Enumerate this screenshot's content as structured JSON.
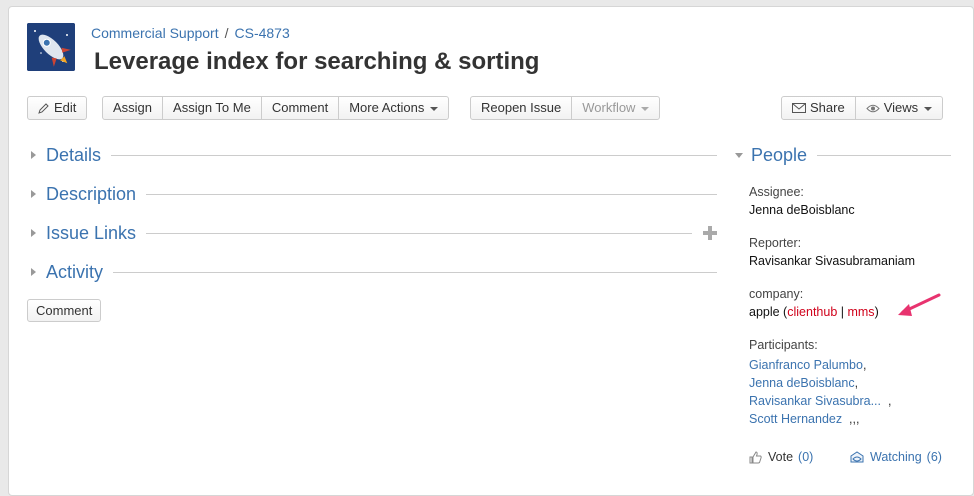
{
  "breadcrumb": {
    "project": "Commercial Support",
    "separator": "/",
    "issue_key": "CS-4873"
  },
  "title": "Leverage index for searching & sorting",
  "toolbar": {
    "edit": "Edit",
    "assign": "Assign",
    "assign_to_me": "Assign To Me",
    "comment": "Comment",
    "more_actions": "More Actions",
    "reopen_issue": "Reopen Issue",
    "workflow": "Workflow",
    "share": "Share",
    "views": "Views"
  },
  "sections": {
    "details": "Details",
    "description": "Description",
    "issue_links": "Issue Links",
    "activity": "Activity"
  },
  "comment_button": "Comment",
  "people": {
    "heading": "People",
    "assignee_label": "Assignee:",
    "assignee": "Jenna deBoisblanc",
    "reporter_label": "Reporter:",
    "reporter": "Ravisankar Sivasubramaniam",
    "company_label": "company:",
    "company_prefix": "apple (",
    "company_link1": "clienthub",
    "company_sep": " | ",
    "company_link2": "mms",
    "company_suffix": ")",
    "participants_label": "Participants:",
    "participants": [
      "Gianfranco Palumbo",
      "Jenna deBoisblanc",
      "Ravisankar Sivasubra...",
      "Scott Hernandez"
    ],
    "participant_suffixes": [
      ",",
      ",",
      "  ,",
      "  ,,,"
    ],
    "vote_label": "Vote",
    "vote_count": "(0)",
    "watching_label": "Watching",
    "watching_count": "(6)"
  },
  "colors": {
    "link": "#3b73af",
    "accent_red": "#d0021b",
    "annotation_arrow": "#e8336f"
  },
  "icons": [
    "rocket-avatar-icon",
    "pencil-icon",
    "envelope-icon",
    "eye-icon",
    "plus-icon",
    "thumbs-up-icon",
    "watch-eye-icon"
  ]
}
